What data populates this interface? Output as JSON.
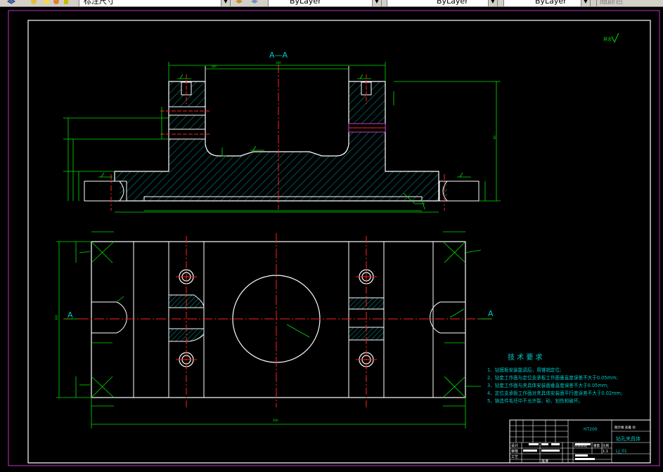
{
  "toolbar": {
    "dimstyle_value": "标注尺寸",
    "layer_value": "ByLayer",
    "linetype_value": "ByLayer",
    "lineweight_value": "ByLayer",
    "plotstyle_value": "随颜色"
  },
  "drawing": {
    "section_label": "A—A",
    "section_arrow_left": "A",
    "section_arrow_right": "A",
    "roughness_note": "其余",
    "tech_title": "技 术 要 求",
    "tech_items": [
      "1、钻模板安装能调后，用锥销定位;",
      "2、钻套工作面与定位支承板工作面垂直度误差不大于0.05mm;",
      "3、钻套工作面与夹具体安装面垂直度误差不大于0.05mm;",
      "4、定位支承板工作面对夹具体安装面平行度误差不大于0.02mm;",
      "5、铸造件毛坯中不允许裂、砂、划伤和破坏。"
    ],
    "title_block": {
      "material": "HT200",
      "part_name": "钻孔夹具体",
      "drawing_no": "LJ_01",
      "school": "图示根 盐雅 坊",
      "scale": "1:1",
      "designer": "设计",
      "checker": "审核",
      "craft": "工艺",
      "approve": "批准",
      "stage": "阶段标记",
      "weight": "重量",
      "ratio": "比例"
    }
  }
}
